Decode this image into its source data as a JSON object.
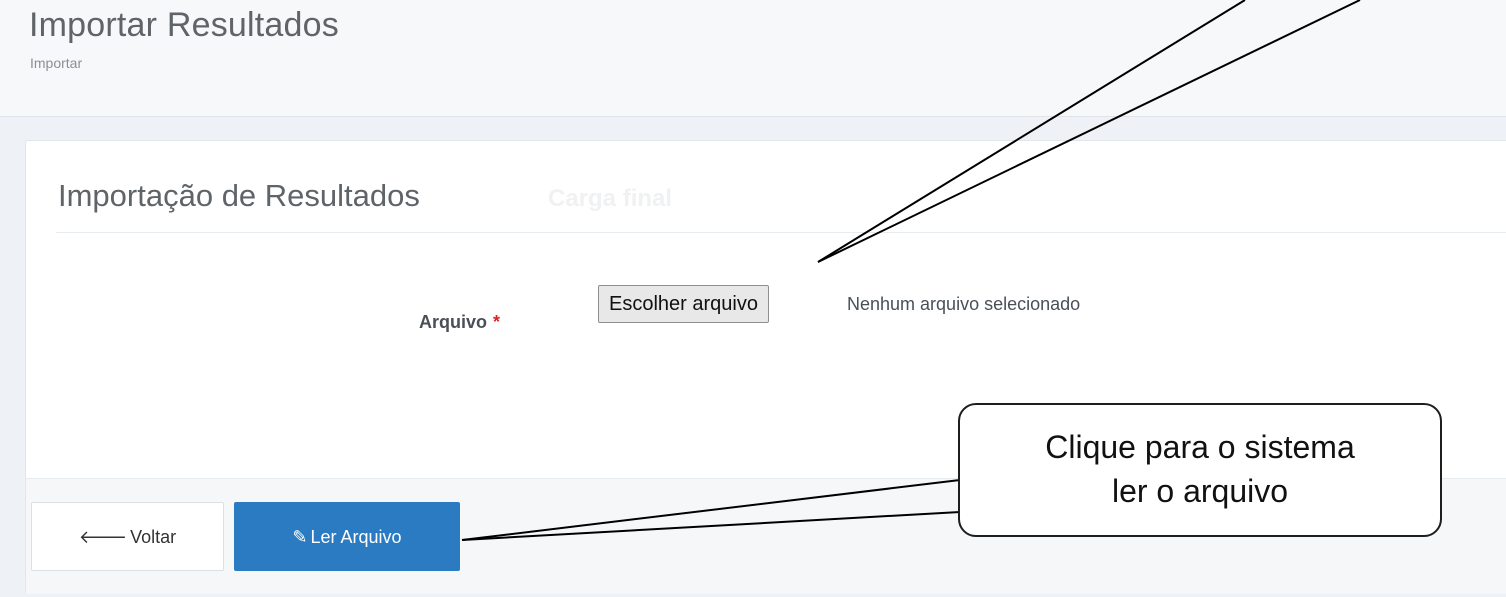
{
  "header": {
    "title": "Importar Resultados",
    "breadcrumb": "Importar"
  },
  "panel": {
    "title": "Importação de Resultados",
    "subtitle": "Carga final"
  },
  "form": {
    "file_label": "Arquivo",
    "required_mark": "*",
    "file_button_label": "Escolher arquivo",
    "file_status": "Nenhum arquivo selecionado"
  },
  "footer": {
    "back_icon": "arrow-left-icon",
    "back_label": "Voltar",
    "read_icon": "pencil-icon",
    "read_label": "Ler Arquivo"
  },
  "callout": {
    "line1": "Clique para o sistema",
    "line2": "ler o arquivo"
  },
  "colors": {
    "primary_button": "#2b7bc2",
    "required": "#e02222"
  }
}
